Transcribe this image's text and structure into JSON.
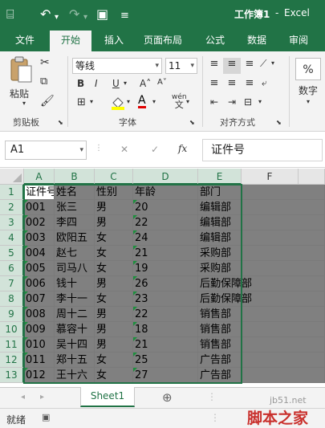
{
  "titlebar": {
    "title": "工作簿1",
    "sep": "-",
    "app": "Excel",
    "save_icon": "⌸",
    "undo_icon": "↶",
    "redo_icon": "↷",
    "camera_icon": "▣",
    "dropdown_icon": "▾",
    "customize_icon": "≡",
    "bg_color": "#217346"
  },
  "tabs": [
    {
      "label": "文件",
      "active": false
    },
    {
      "label": "开始",
      "active": true
    },
    {
      "label": "插入",
      "active": false
    },
    {
      "label": "页面布局",
      "active": false
    },
    {
      "label": "公式",
      "active": false
    },
    {
      "label": "数据",
      "active": false
    },
    {
      "label": "审阅",
      "active": false
    }
  ],
  "ribbon": {
    "clipboard": {
      "paste_label": "粘贴",
      "group_label": "剪贴板"
    },
    "font": {
      "font_name": "等线",
      "font_size": "11",
      "bold": "B",
      "italic": "I",
      "underline": "U",
      "grow": "A˄",
      "shrink": "A˅",
      "font_color": "A",
      "wen": "wén",
      "wen_sub": "文",
      "group_label": "字体"
    },
    "alignment": {
      "group_label": "对齐方式"
    },
    "number": {
      "percent": "%",
      "label": "数字"
    }
  },
  "formula_bar": {
    "name_box": "A1",
    "cancel": "✕",
    "confirm": "✓",
    "fx": "fx",
    "value": "证件号"
  },
  "columns": [
    "A",
    "B",
    "C",
    "D",
    "E",
    "F"
  ],
  "rows": [
    "1",
    "2",
    "3",
    "4",
    "5",
    "6",
    "7",
    "8",
    "9",
    "10",
    "11",
    "12",
    "13"
  ],
  "table": [
    [
      "证件号",
      "姓名",
      "性别",
      "年龄",
      "部门"
    ],
    [
      "001",
      "张三",
      "男",
      "20",
      "编辑部"
    ],
    [
      "002",
      "李四",
      "男",
      "22",
      "编辑部"
    ],
    [
      "003",
      "欧阳五",
      "女",
      "24",
      "编辑部"
    ],
    [
      "004",
      "赵七",
      "女",
      "21",
      "采购部"
    ],
    [
      "005",
      "司马八",
      "女",
      "19",
      "采购部"
    ],
    [
      "006",
      "钱十",
      "男",
      "26",
      "后勤保障部"
    ],
    [
      "007",
      "李十一",
      "女",
      "23",
      "后勤保障部"
    ],
    [
      "008",
      "周十二",
      "男",
      "22",
      "销售部"
    ],
    [
      "009",
      "慕容十",
      "男",
      "18",
      "销售部"
    ],
    [
      "010",
      "吴十四",
      "男",
      "21",
      "销售部"
    ],
    [
      "011",
      "郑十五",
      "女",
      "25",
      "广告部"
    ],
    [
      "012",
      "王十六",
      "女",
      "27",
      "广告部"
    ]
  ],
  "sheets": {
    "active": "Sheet1",
    "add_icon": "⊕",
    "nav_left": "◂",
    "nav_right": "▸"
  },
  "status": {
    "ready": "就绪"
  },
  "watermark": {
    "site": "jb51.net",
    "name": "脚本之家"
  },
  "colors": {
    "accent": "#217346",
    "selection_fill": "#808080",
    "triangle": "#1e8f3e"
  }
}
